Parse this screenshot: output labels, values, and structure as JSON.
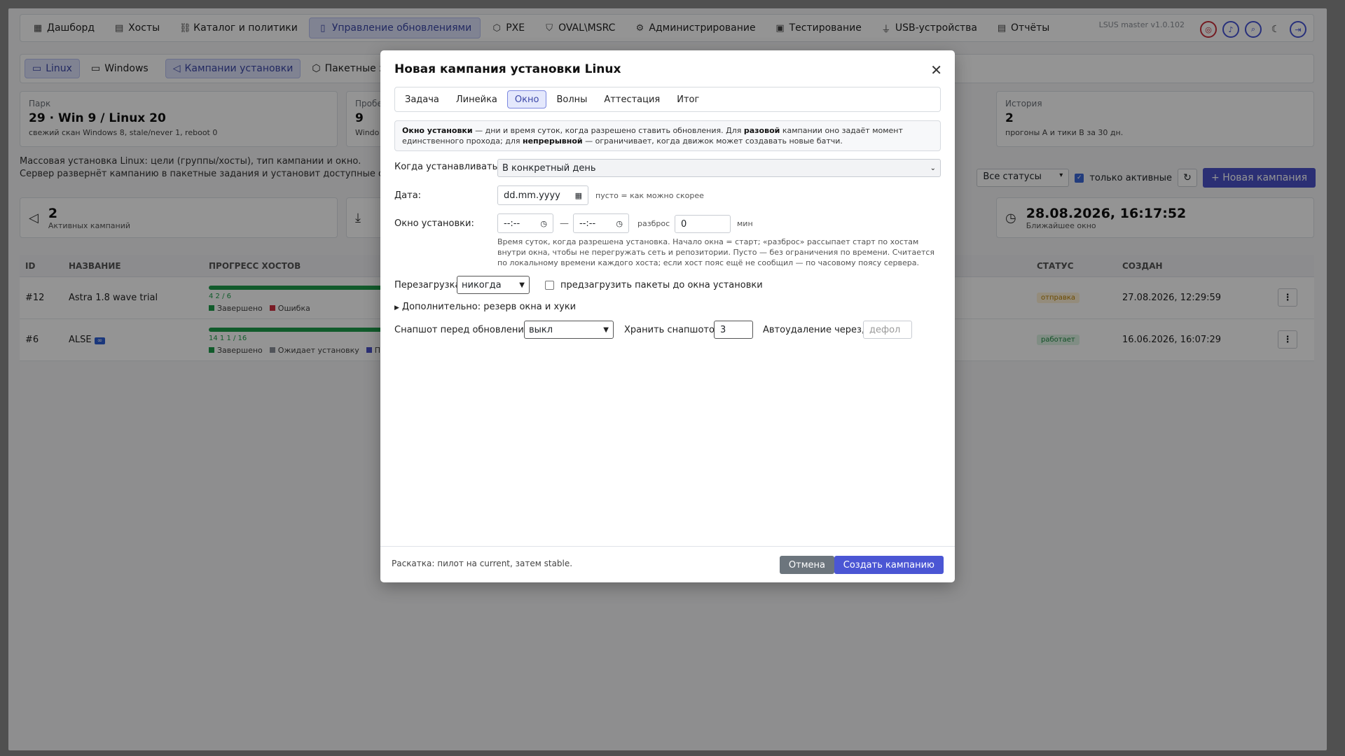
{
  "topnav": {
    "items": [
      {
        "icon": "▦",
        "label": "Дашборд"
      },
      {
        "icon": "▤",
        "label": "Хосты"
      },
      {
        "icon": "⛓",
        "label": "Каталог и политики"
      },
      {
        "icon": "▯",
        "label": "Управление обновлениями",
        "active": true
      },
      {
        "icon": "⬡",
        "label": "PXE"
      },
      {
        "icon": "⛉",
        "label": "OVAL\\MSRC"
      },
      {
        "icon": "⚙",
        "label": "Администрирование"
      },
      {
        "icon": "▣",
        "label": "Тестирование"
      },
      {
        "icon": "⏚",
        "label": "USB-устройства"
      },
      {
        "icon": "▤",
        "label": "Отчёты"
      }
    ],
    "version": "LSUS master v1.0.102"
  },
  "subnav": {
    "linux": "Linux",
    "windows": "Windows",
    "campaigns": "Кампании установки",
    "batch": "Пакетные задачи"
  },
  "cards": {
    "park": {
      "label": "Парк",
      "value": "29 · Win 9 / Linux 20",
      "sub": "свежий скан Windows 8, stale/never 1, reboot 0"
    },
    "probe": {
      "label": "Пробе",
      "value": "9",
      "sub": "Windo"
    },
    "history": {
      "label": "История",
      "value": "2",
      "sub": "прогоны A и тики B за 30 дн."
    }
  },
  "intro": {
    "line1": "Массовая установка Linux: цели (группы/хосты), тип кампании и окно.",
    "line2": "Сервер развернёт кампанию в пакетные задания и установит доступные обновления."
  },
  "filters": {
    "status": "Все статусы",
    "only_active": "только активные",
    "new_campaign": "+ Новая кампания"
  },
  "kpis": {
    "active": {
      "value": "2",
      "label": "Активных кампаний"
    },
    "nearest": {
      "value": "28.08.2026, 16:17:52",
      "label": "Ближайшее окно"
    }
  },
  "table": {
    "headers": {
      "id": "ID",
      "name": "НАЗВАНИЕ",
      "progress": "ПРОГРЕСС ХОСТОВ",
      "status": "СТАТУС",
      "created": "СОЗДАН"
    },
    "rows": [
      {
        "id": "#12",
        "name": "Astra 1.8 wave trial",
        "counts": "4 2 / 6",
        "legend": [
          "Завершено",
          "Ошибка"
        ],
        "status": "отправка",
        "created": "27.08.2026, 12:29:59"
      },
      {
        "id": "#6",
        "name": "ALSE",
        "tag": "∞",
        "counts": "14 1 1 / 16",
        "legend": [
          "Завершено",
          "Ожидает установку",
          "Приос"
        ],
        "status": "работает",
        "created": "16.06.2026, 16:07:29"
      }
    ]
  },
  "modal": {
    "title": "Новая кампания установки Linux",
    "tabs": [
      "Задача",
      "Линейка",
      "Окно",
      "Волны",
      "Аттестация",
      "Итог"
    ],
    "active_tab": "Окно",
    "info": {
      "b1": "Окно установки",
      "t1": " — дни и время суток, когда разрешено ставить обновления. Для ",
      "b2": "разовой",
      "t2": " кампании оно задаёт момент единственного прохода; для ",
      "b3": "непрерывной",
      "t3": " — ограничивает, когда движок может создавать новые батчи."
    },
    "when_label": "Когда устанавливать:",
    "when_value": "В конкретный день",
    "date_label": "Дата:",
    "date_value": "dd.mm.yyyy",
    "date_hint": "пусто = как можно скорее",
    "window_label": "Окно установки:",
    "time_from": "--:--",
    "dash": "—",
    "spread_label": "разброс",
    "spread_value": "0",
    "spread_unit": "мин",
    "help": "Время суток, когда разрешена установка. Начало окна = старт; «разброс» рассыпает старт по хостам внутри окна, чтобы не перегружать сеть и репозитории. Пусто — без ограничения по времени. Считается по локальному времени каждого хоста; если хост пояс ещё не сообщил — по часовому поясу сервера.",
    "reboot_label": "Перезагрузка:",
    "reboot_value": "никогда",
    "preload_label": "предзагрузить пакеты до окна установки",
    "advanced_label": "Дополнительно: резерв окна и хуки",
    "snapshot_label": "Снапшот перед обновлением:",
    "snapshot_value": "выкл",
    "keep_label": "Хранить снапшотов:",
    "keep_value": "3",
    "autodelete_label": "Автоудаление через, ч:",
    "autodelete_placeholder": "дефол",
    "footer_text": "Раскатка: пилот на current, затем stable.",
    "cancel": "Отмена",
    "create": "Создать кампанию"
  }
}
